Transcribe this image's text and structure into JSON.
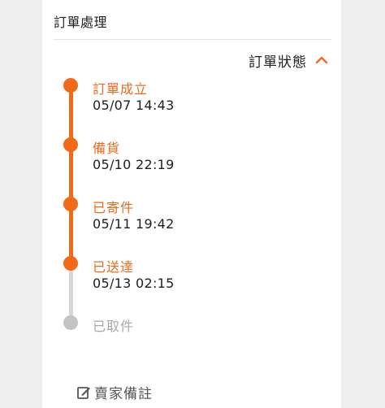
{
  "section": {
    "title": "訂單處理"
  },
  "status_panel": {
    "toggle_label": "訂單狀態",
    "expanded": true,
    "accent_color": "#f26a18",
    "inactive_color": "#c4c4c4"
  },
  "timeline": [
    {
      "label": "訂單成立",
      "time": "05/07 14:43",
      "completed": true
    },
    {
      "label": "備貨",
      "time": "05/10 22:19",
      "completed": true
    },
    {
      "label": "已寄件",
      "time": "05/11 19:42",
      "completed": true
    },
    {
      "label": "已送達",
      "time": "05/13 02:15",
      "completed": true
    },
    {
      "label": "已取件",
      "time": "",
      "completed": false
    }
  ],
  "footer": {
    "seller_note_label": "賣家備註",
    "seller_note_icon": "edit-icon"
  }
}
